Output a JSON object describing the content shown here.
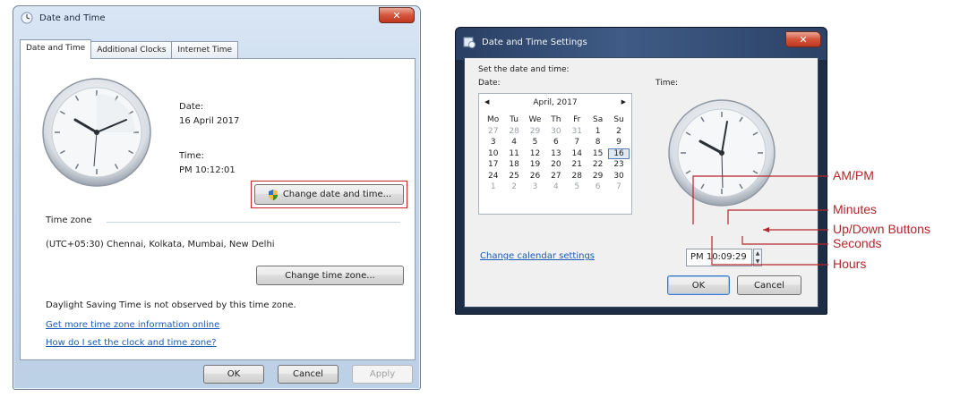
{
  "window1": {
    "title": "Date and Time",
    "close_glyph": "✕",
    "tabs": [
      {
        "label": "Date and Time"
      },
      {
        "label": "Additional Clocks"
      },
      {
        "label": "Internet Time"
      }
    ],
    "date_label": "Date:",
    "date_value": "16 April 2017",
    "time_label": "Time:",
    "time_value": "PM 10:12:01",
    "change_datetime_button": "Change date and time...",
    "timezone_label": "Time zone",
    "timezone_value": "(UTC+05:30) Chennai, Kolkata, Mumbai, New Delhi",
    "change_timezone_button": "Change time zone...",
    "dst_text": "Daylight Saving Time is not observed by this time zone.",
    "link_more_info": "Get more time zone information online",
    "link_how_to": "How do I set the clock and time zone?",
    "ok_button": "OK",
    "cancel_button": "Cancel",
    "apply_button": "Apply"
  },
  "window2": {
    "title": "Date and Time Settings",
    "close_glyph": "✕",
    "set_label": "Set the date and time:",
    "date_label": "Date:",
    "time_label": "Time:",
    "calendar": {
      "prev": "◀",
      "next": "▶",
      "month": "April, 2017",
      "weekdays": [
        "Mo",
        "Tu",
        "We",
        "Th",
        "Fr",
        "Sa",
        "Su"
      ],
      "weeks": [
        [
          "27",
          "28",
          "29",
          "30",
          "31",
          "1",
          "2"
        ],
        [
          "3",
          "4",
          "5",
          "6",
          "7",
          "8",
          "9"
        ],
        [
          "10",
          "11",
          "12",
          "13",
          "14",
          "15",
          "16"
        ],
        [
          "17",
          "18",
          "19",
          "20",
          "21",
          "22",
          "23"
        ],
        [
          "24",
          "25",
          "26",
          "27",
          "28",
          "29",
          "30"
        ],
        [
          "1",
          "2",
          "3",
          "4",
          "5",
          "6",
          "7"
        ]
      ],
      "selected_day": "16"
    },
    "time_value": "PM 10:09:29",
    "spin_up": "▲",
    "spin_down": "▼",
    "calendar_link": "Change calendar settings",
    "ok_button": "OK",
    "cancel_button": "Cancel"
  },
  "callouts": {
    "am_pm": "AM/PM",
    "minutes": "Minutes",
    "up_down": "Up/Down Buttons",
    "seconds": "Seconds",
    "hours": "Hours",
    "color": "#b5262b"
  },
  "colors": {
    "link": "#1a5bb4",
    "highlight_border": "#c9252b",
    "close_button": "#c0361f"
  }
}
